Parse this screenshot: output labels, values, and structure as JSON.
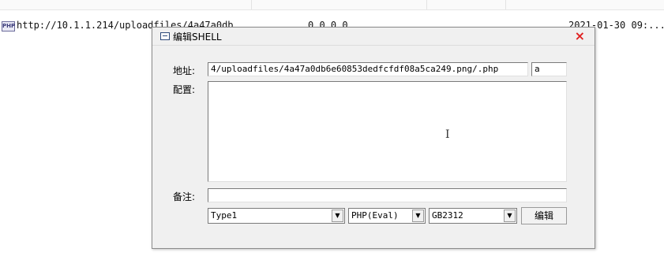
{
  "list_row": {
    "type_icon": "PHP",
    "url": "http://10.1.1.214/uploadfiles/4a47a0db...",
    "ip": "0.0.0.0",
    "date": "2021-01-30 09:..."
  },
  "dialog": {
    "title": "编辑SHELL",
    "close_label": "×",
    "address_label": "地址:",
    "address_value": "4/uploadfiles/4a47a0db6e60853dedfcfdf08a5ca249.png/.php",
    "password_value": "a",
    "config_label": "配置:",
    "config_value": "",
    "note_label": "备注:",
    "note_value": "",
    "type_selected": "Type1",
    "script_selected": "PHP(Eval)",
    "encoding_selected": "GB2312",
    "edit_button_label": "编辑",
    "dropdown_arrow": "▼",
    "text_cursor": "I"
  },
  "colors": {
    "close": "#e02020",
    "dialog_bg": "#f0f0f0"
  }
}
